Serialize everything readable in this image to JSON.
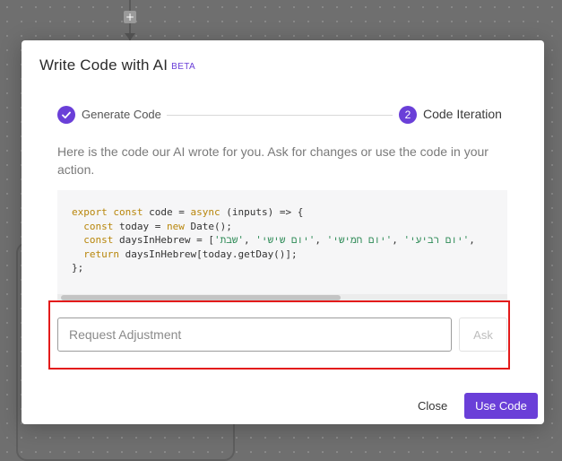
{
  "modal": {
    "title": "Write Code with AI",
    "badge": "BETA"
  },
  "stepper": {
    "step1": {
      "number": "1",
      "label": "Generate Code",
      "icon": "check-icon",
      "status": "complete"
    },
    "step2": {
      "number": "2",
      "label": "Code Iteration",
      "status": "active"
    }
  },
  "description": "Here is the code our AI wrote for you. Ask for changes or use the code in your action.",
  "code": {
    "line1_kw1": "export",
    "line1_kw2": "const",
    "line1_a": " code = ",
    "line1_kw3": "async",
    "line1_b": " (inputs) => {",
    "line2_kw1": "const",
    "line2_a": " today = ",
    "line2_kw2": "new",
    "line2_b": " Date();",
    "line3_kw1": "const",
    "line3_a": " daysInHebrew = [",
    "line3_s1": "'שבת'",
    "line3_s2": "'יום שישי'",
    "line3_s3": "'יום חמישי'",
    "line3_s4": "'יום רביעי'",
    "line3_tail": ", ",
    "line4_kw1": "return",
    "line4_a": " daysInHebrew[today.getDay()];",
    "line5": "};"
  },
  "adjustment": {
    "placeholder": "Request Adjustment",
    "value": "",
    "ask_label": "Ask"
  },
  "footer": {
    "close_label": "Close",
    "use_code_label": "Use Code"
  },
  "colors": {
    "accent": "#6a3fd8",
    "highlight": "#e31b1b"
  }
}
